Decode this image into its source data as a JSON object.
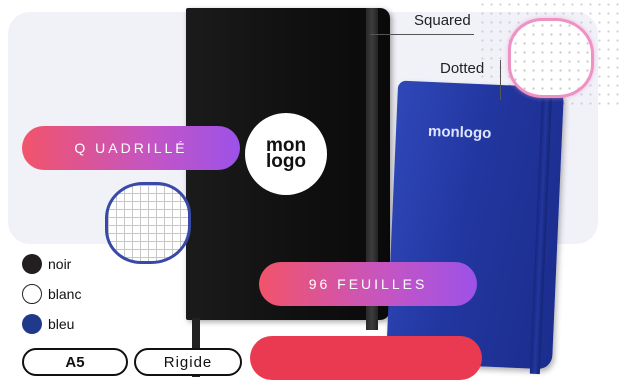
{
  "callouts": {
    "squared": "Squared",
    "dotted": "Dotted"
  },
  "notebook_black": {
    "logo_line1": "mon",
    "logo_line2": "logo"
  },
  "notebook_blue": {
    "logo": "monlogo"
  },
  "pills": {
    "ruling": "Q UADRILLÉ",
    "pages": "96 FEUILLES"
  },
  "colors": [
    {
      "label": "noir",
      "hex": "#231f20"
    },
    {
      "label": "blanc",
      "hex": "#ffffff"
    },
    {
      "label": "bleu",
      "hex": "#1f3a8a"
    }
  ],
  "tags": {
    "size": "A5",
    "cover": "Rigide"
  },
  "accent_colors": {
    "gradient_start": "#f2546a",
    "gradient_end": "#9c52e8",
    "red": "#ea3a51",
    "panel": "#f1f1f8"
  },
  "icons": {
    "dotted_sample": "dotted-paper-sample",
    "grid_sample": "squared-paper-sample"
  }
}
